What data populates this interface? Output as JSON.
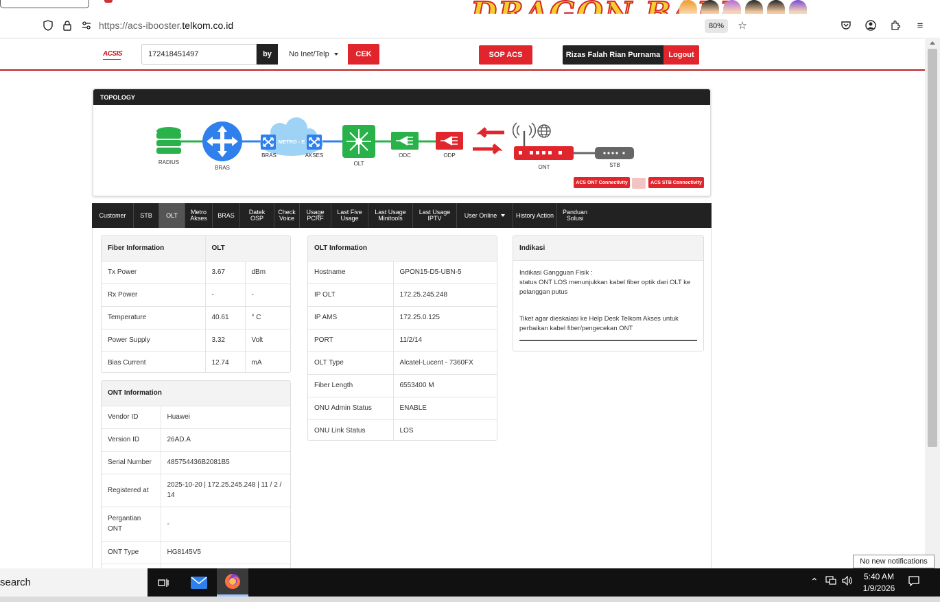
{
  "browser": {
    "url_prefix": "https://acs-ibooster.",
    "url_domain": "telkom.co.id",
    "zoom": "80%",
    "banner_text": "DRAGON BALL"
  },
  "header": {
    "logo": "ACSIS",
    "search_value": "172418451497",
    "by_label": "by",
    "select_value": "No Inet/Telp",
    "cek_label": "CEK",
    "sop_label": "SOP ACS",
    "user_name": "Rizas Falah Rian Purnama",
    "logout_label": "Logout"
  },
  "topology": {
    "title": "TOPOLOGY",
    "nodes": [
      "RADIUS",
      "BRAS",
      "BRAS",
      "AKSES",
      "OLT",
      "ODC",
      "ODP",
      "ONT",
      "STB"
    ],
    "cloud_label": "METRO - E",
    "acs_ont_label": "ACS ONT Connectivity",
    "acs_stb_label": "ACS STB Connectivity",
    "colors": {
      "green": "#2ab24a",
      "blue": "#2f80ed",
      "red": "#e0262c"
    }
  },
  "nav": {
    "tabs": [
      {
        "label": "Customer"
      },
      {
        "label": "STB"
      },
      {
        "label": "OLT",
        "active": true
      },
      {
        "label": "Metro\nAkses"
      },
      {
        "label": "BRAS"
      },
      {
        "label": "Datek\nOSP"
      },
      {
        "label": "Check\nVoice"
      },
      {
        "label": "Usage\nPCRF"
      },
      {
        "label": "Last Five\nUsage"
      },
      {
        "label": "Last Usage\nMinitools"
      },
      {
        "label": "Last Usage\nIPTV"
      },
      {
        "label": "User Online"
      },
      {
        "label": "History Action"
      },
      {
        "label": "Panduan\nSolusi"
      }
    ]
  },
  "fiber": {
    "title": "Fiber Information",
    "col": "OLT",
    "rows": [
      {
        "label": "Tx Power",
        "value": "3.67",
        "unit": "dBm"
      },
      {
        "label": "Rx Power",
        "value": "-",
        "unit": "-"
      },
      {
        "label": "Temperature",
        "value": "40.61",
        "unit": "° C"
      },
      {
        "label": "Power Supply",
        "value": "3.32",
        "unit": "Volt"
      },
      {
        "label": "Bias Current",
        "value": "12.74",
        "unit": "mA"
      }
    ]
  },
  "ont": {
    "title": "ONT Information",
    "rows": [
      {
        "label": "Vendor ID",
        "value": "Huawei"
      },
      {
        "label": "Version ID",
        "value": "26AD.A"
      },
      {
        "label": "Serial Number",
        "value": "485754436B2081B5"
      },
      {
        "label": "Registered at",
        "value": "2025-10-20 | 172.25.245.248 | 11 / 2 / 14"
      },
      {
        "label": "Pergantian ONT",
        "value": "-"
      },
      {
        "label": "ONT Type",
        "value": "HG8145V5"
      }
    ]
  },
  "olt": {
    "title": "OLT Information",
    "rows": [
      {
        "label": "Hostname",
        "value": "GPON15-D5-UBN-5"
      },
      {
        "label": "IP OLT",
        "value": "172.25.245.248"
      },
      {
        "label": "IP AMS",
        "value": "172.25.0.125"
      },
      {
        "label": "PORT",
        "value": "11/2/14"
      },
      {
        "label": "OLT Type",
        "value": "Alcatel-Lucent - 7360FX"
      },
      {
        "label": "Fiber Length",
        "value": "6553400 M"
      },
      {
        "label": "ONU Admin Status",
        "value": "ENABLE"
      },
      {
        "label": "ONU Link Status",
        "value": "LOS"
      }
    ]
  },
  "indikasi": {
    "title": "Indikasi",
    "line1": "Indikasi Gangguan Fisik :",
    "line2": "status ONT LOS menunjukkan kabel fiber optik dari OLT ke pelanggan putus",
    "line3": "Tiket agar dieskalasi ke Help Desk Telkom Akses untuk perbaikan kabel fiber/pengecekan ONT"
  },
  "taskbar": {
    "search": "search",
    "time": "5:40 AM",
    "date": "1/9/2026",
    "notification": "No new notifications"
  }
}
